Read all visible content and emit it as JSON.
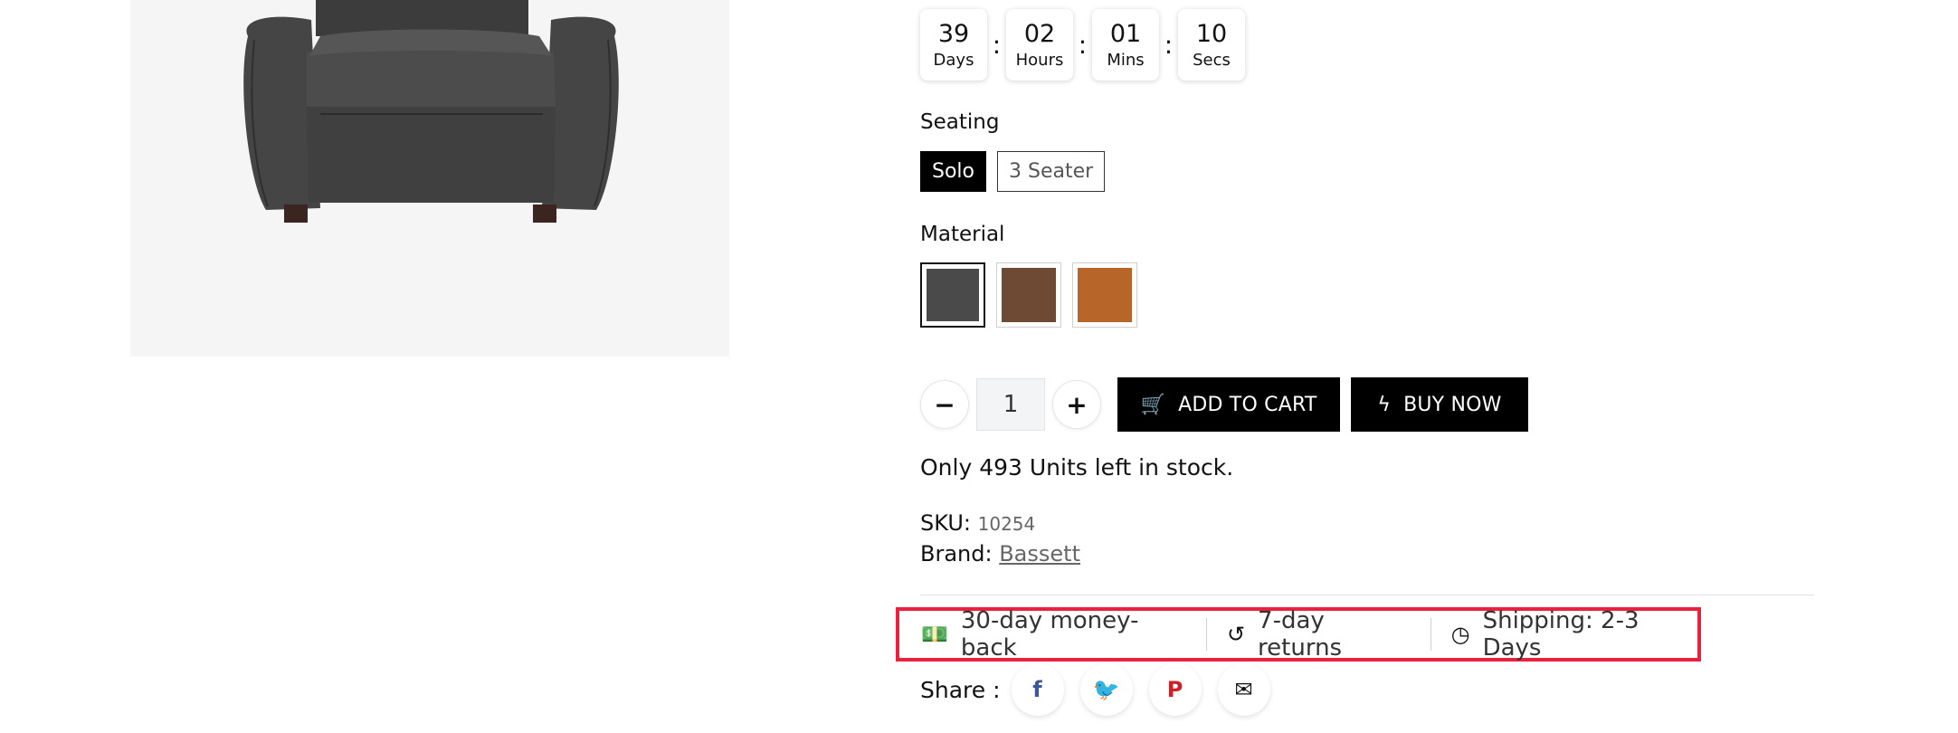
{
  "product_image": {
    "alt_icon": "armchair-image"
  },
  "countdown": [
    {
      "value": "39",
      "label": "Days"
    },
    {
      "value": "02",
      "label": "Hours"
    },
    {
      "value": "01",
      "label": "Mins"
    },
    {
      "value": "10",
      "label": "Secs"
    }
  ],
  "countdown_separator": ":",
  "seating": {
    "label": "Seating",
    "options": [
      "Solo",
      "3 Seater"
    ],
    "selected": "Solo"
  },
  "material": {
    "label": "Material",
    "swatches": [
      {
        "name": "charcoal",
        "color": "#4a4a4a",
        "selected": true
      },
      {
        "name": "brown",
        "color": "#6e4a35",
        "selected": false
      },
      {
        "name": "tan",
        "color": "#b8652a",
        "selected": false
      }
    ]
  },
  "quantity": {
    "value": "1",
    "minus_icon": "minus-icon",
    "plus_icon": "plus-icon"
  },
  "buttons": {
    "add_to_cart": "ADD TO CART",
    "add_to_cart_icon": "cart-icon",
    "buy_now": "BUY NOW",
    "buy_now_icon": "bolt-icon"
  },
  "stock_text": "Only 493 Units left in stock.",
  "sku": {
    "label": "SKU:",
    "value": "10254"
  },
  "brand": {
    "label": "Brand:",
    "value": "Bassett"
  },
  "trust": [
    {
      "icon": "money-icon",
      "text": "30-day money-back"
    },
    {
      "icon": "undo-icon",
      "text": "7-day returns"
    },
    {
      "icon": "clock-icon",
      "text": "Shipping: 2-3 Days"
    }
  ],
  "share": {
    "label": "Share :",
    "items": [
      {
        "icon": "facebook-icon",
        "glyph": "f",
        "color": "#3b5998"
      },
      {
        "icon": "twitter-icon",
        "glyph": "🐦",
        "color": "#1da1f2"
      },
      {
        "icon": "pinterest-icon",
        "glyph": "P",
        "color": "#cb2027"
      },
      {
        "icon": "envelope-icon",
        "glyph": "✉",
        "color": "#111111"
      }
    ]
  },
  "highlight_color": "#e8213f"
}
